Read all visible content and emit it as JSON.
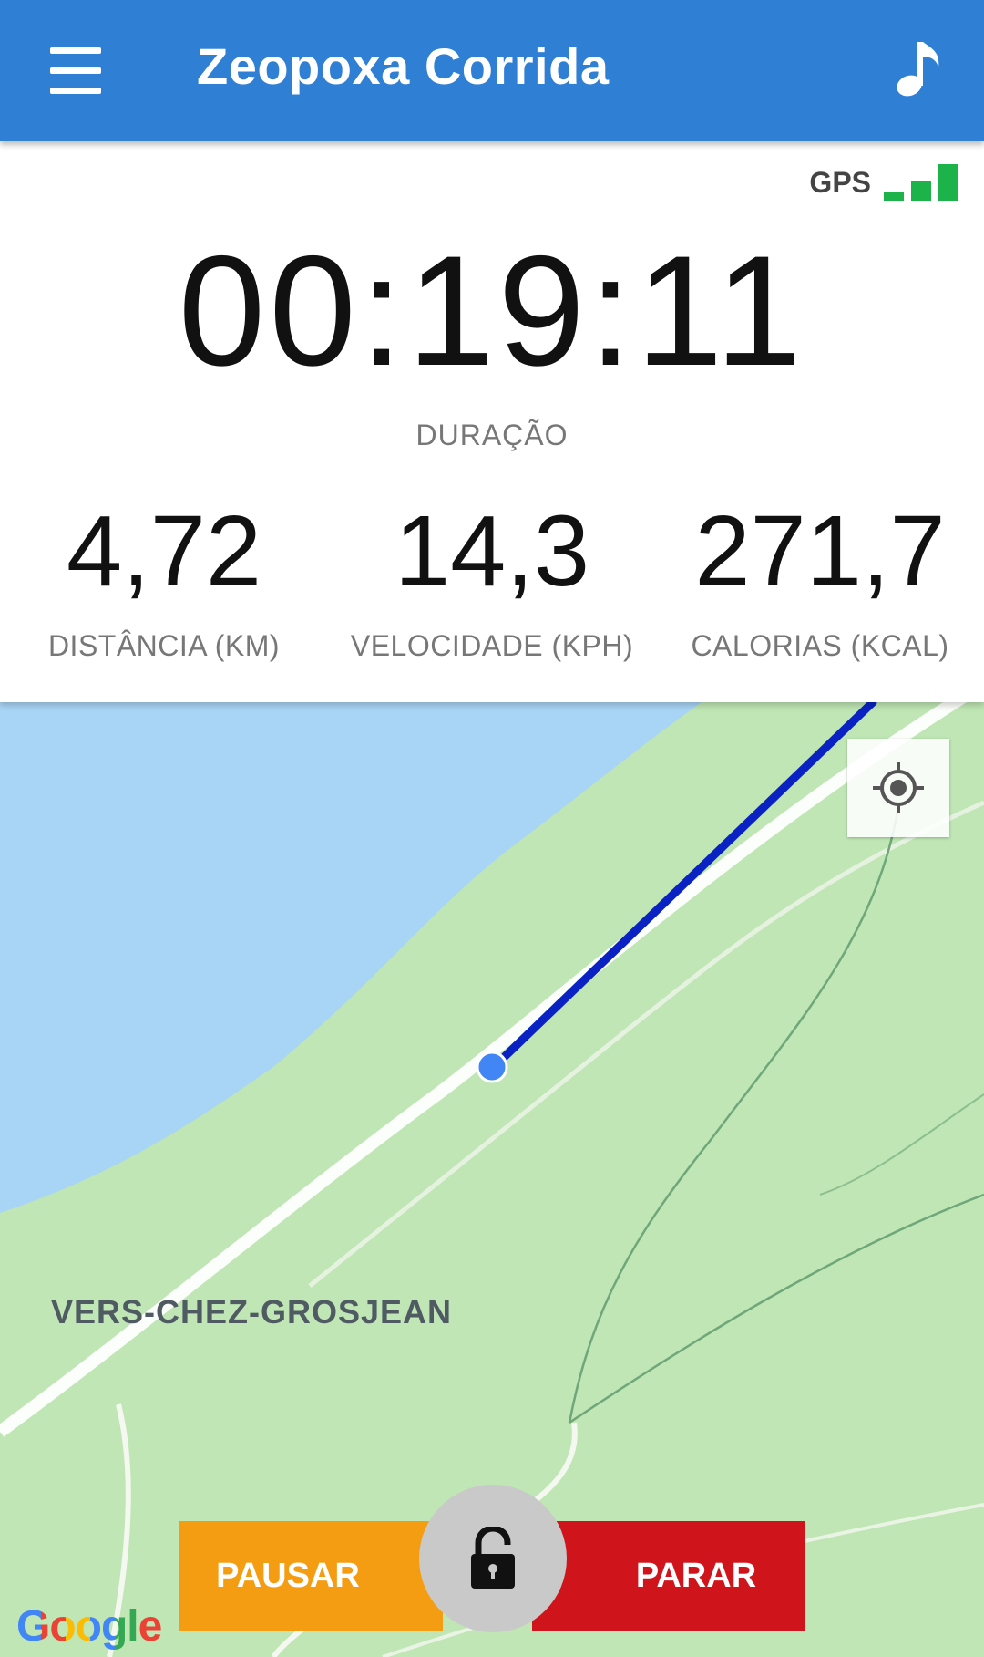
{
  "app": {
    "title": "Zeopoxa Corrida",
    "menu_icon": "hamburger-menu-icon",
    "music_icon": "music-note-icon",
    "accent_color": "#2f7fd4"
  },
  "gps": {
    "label": "GPS",
    "signal_bars": 3,
    "signal_color": "#1bb34a"
  },
  "duration": {
    "value": "00:19:11",
    "label": "DURAÇÃO"
  },
  "metrics": [
    {
      "value": "4,72",
      "label": "DISTÂNCIA (KM)"
    },
    {
      "value": "14,3",
      "label": "VELOCIDADE (KPH)"
    },
    {
      "value": "271,7",
      "label": "CALORIAS (KCAL)"
    }
  ],
  "map": {
    "place_label": "VERS-CHEZ-GROSJEAN",
    "attribution": "Google",
    "locate_icon": "my-location-icon",
    "route_color": "#0a22c4",
    "water_color": "#a8d4f5",
    "land_color": "#bfe6b4"
  },
  "controls": {
    "pause_label": "PAUSAR",
    "stop_label": "PARAR",
    "lock_icon": "unlocked-padlock-icon",
    "pause_color": "#f59d12",
    "stop_color": "#d0141b"
  }
}
